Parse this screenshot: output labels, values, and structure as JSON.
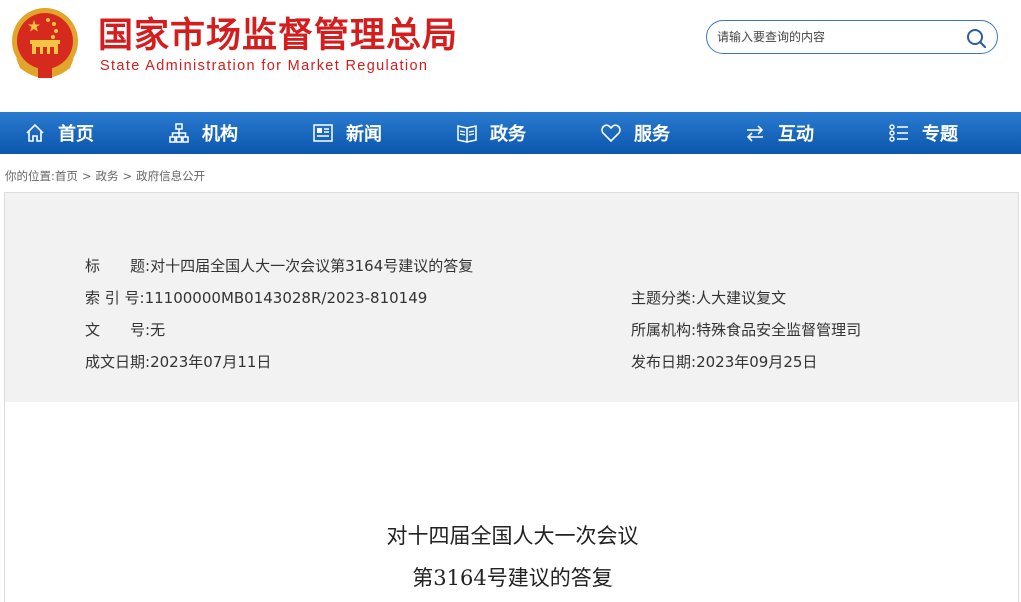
{
  "header": {
    "title_cn": "国家市场监督管理总局",
    "title_en": "State Administration for Market Regulation",
    "search_placeholder": "请输入要查询的内容"
  },
  "nav": {
    "items": [
      {
        "label": "首页",
        "icon": "home-icon"
      },
      {
        "label": "机构",
        "icon": "org-icon"
      },
      {
        "label": "新闻",
        "icon": "news-icon"
      },
      {
        "label": "政务",
        "icon": "affairs-icon"
      },
      {
        "label": "服务",
        "icon": "heart-icon"
      },
      {
        "label": "互动",
        "icon": "exchange-icon"
      },
      {
        "label": "专题",
        "icon": "list-icon"
      }
    ]
  },
  "breadcrumb": {
    "prefix": "你的位置:",
    "items": [
      "首页",
      "政务",
      "政府信息公开"
    ],
    "sep": ">"
  },
  "info": {
    "title_label": "标　　题:",
    "title_value": "对十四届全国人大一次会议第3164号建议的答复",
    "index_label": "索 引 号:",
    "index_value": "11100000MB0143028R/2023-810149",
    "docno_label": "文　　号:",
    "docno_value": "无",
    "date_label": "成文日期:",
    "date_value": "2023年07月11日",
    "topic_label": "主题分类:",
    "topic_value": "人大建议复文",
    "org_label": "所属机构:",
    "org_value": "特殊食品安全监督管理司",
    "pub_label": "发布日期:",
    "pub_value": "2023年09月25日"
  },
  "article": {
    "title_line1": "对十四届全国人大一次会议",
    "title_line2": "第3164号建议的答复"
  },
  "colors": {
    "brand_red": "#d51d1d",
    "nav_blue": "#0b57ad",
    "search_border": "#3a78c6"
  }
}
